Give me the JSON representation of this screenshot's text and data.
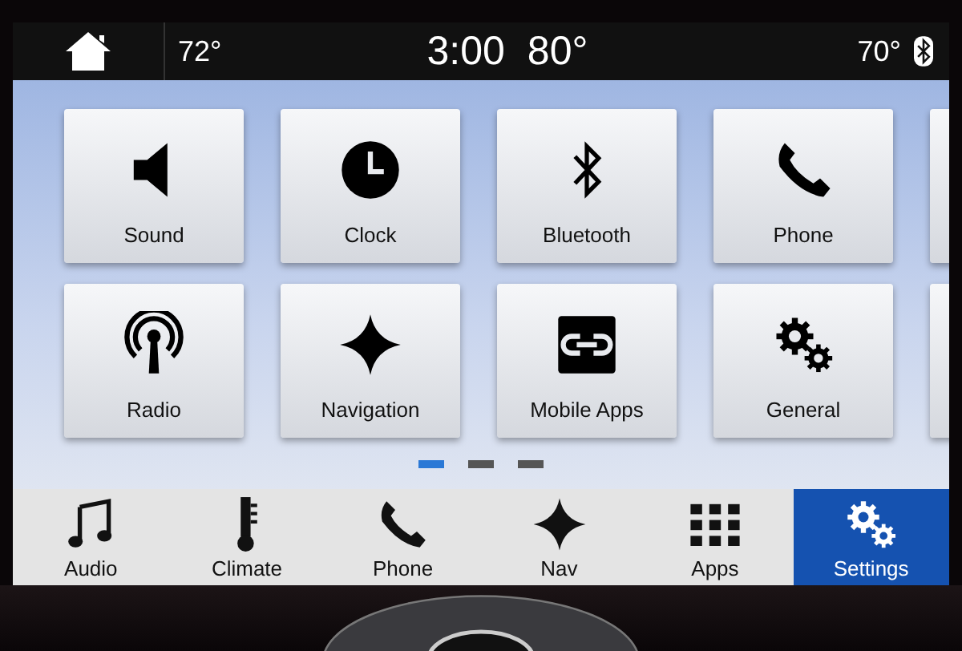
{
  "status_bar": {
    "left_temperature": "72°",
    "time": "3:00",
    "outside_temperature": "80°",
    "right_temperature": "70°"
  },
  "tiles": [
    {
      "label": "Sound"
    },
    {
      "label": "Clock"
    },
    {
      "label": "Bluetooth"
    },
    {
      "label": "Phone"
    },
    {
      "label": "Radio"
    },
    {
      "label": "Navigation"
    },
    {
      "label": "Mobile Apps"
    },
    {
      "label": "General"
    }
  ],
  "page_dots": [
    {
      "selected": true
    },
    {
      "selected": false
    },
    {
      "selected": false
    }
  ],
  "nav_bar": [
    {
      "label": "Audio",
      "selected": false
    },
    {
      "label": "Climate",
      "selected": false
    },
    {
      "label": "Phone",
      "selected": false
    },
    {
      "label": "Nav",
      "selected": false
    },
    {
      "label": "Apps",
      "selected": false
    },
    {
      "label": "Settings",
      "selected": true
    }
  ]
}
